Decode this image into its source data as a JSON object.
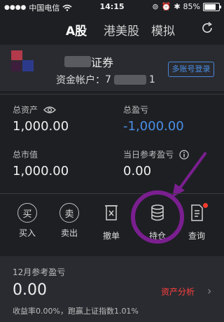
{
  "status": {
    "carrier": "中国电信",
    "time": "14:15",
    "battery": "85%"
  },
  "tabs": [
    "A股",
    "港美股",
    "模拟"
  ],
  "account": {
    "broker_suffix": "证券",
    "account_label": "资金帐户：",
    "account_prefix": "7",
    "account_suffix": "1",
    "multi_login": "多账号登录"
  },
  "stats": {
    "total_assets_label": "总资产",
    "total_assets": "1,000.00",
    "total_pnl_label": "总盈亏",
    "total_pnl": "-1,000.00",
    "market_value_label": "总市值",
    "market_value": "1,000.00",
    "daily_pnl_label": "当日参考盈亏",
    "daily_pnl": "0.00"
  },
  "actions": [
    {
      "label": "买入",
      "glyph": "买"
    },
    {
      "label": "卖出",
      "glyph": "卖"
    },
    {
      "label": "撤单"
    },
    {
      "label": "持仓"
    },
    {
      "label": "查询"
    }
  ],
  "monthly": {
    "label": "12月参考盈亏",
    "value": "0.00",
    "analysis": "资产分析",
    "summary": "收益率0.00%，跑赢上证指数1.01%"
  },
  "colors": {
    "accent": "#4a8fe6",
    "red": "#ff4040",
    "highlight": "#7a1f8f"
  }
}
